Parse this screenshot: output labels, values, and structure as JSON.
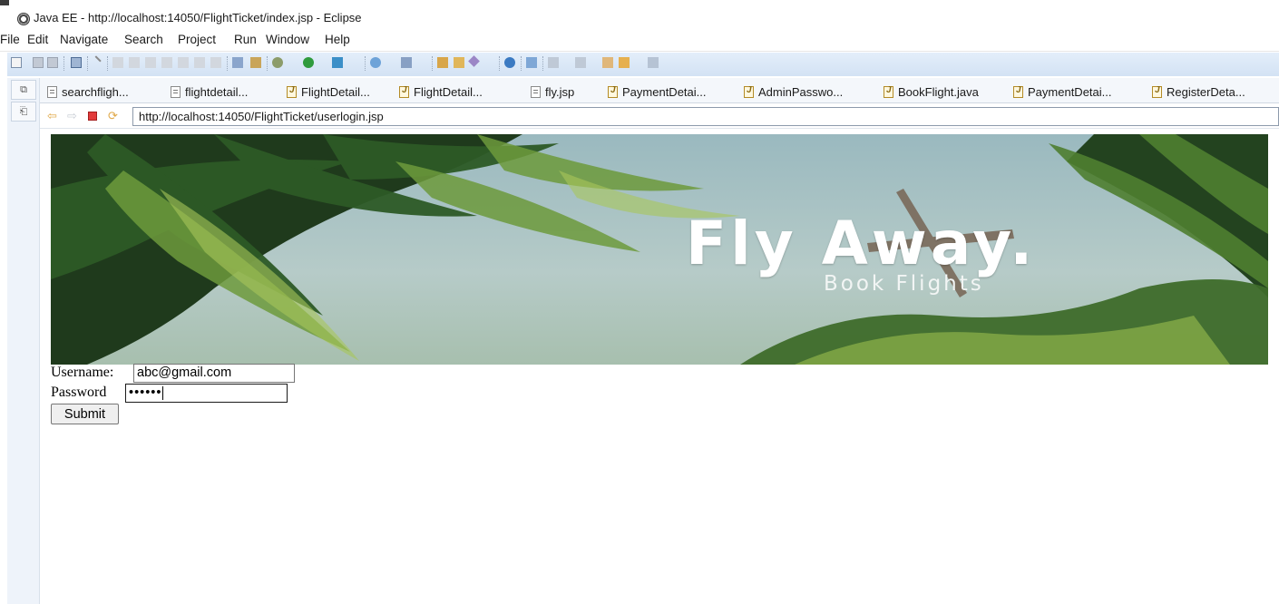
{
  "window": {
    "title": "Java EE - http://localhost:14050/FlightTicket/index.jsp - Eclipse"
  },
  "menu": [
    "File",
    "Edit",
    "Navigate",
    "Search",
    "Project",
    "Run",
    "Window",
    "Help"
  ],
  "tabs": [
    {
      "label": "searchfligh...",
      "icon": "jsp-file-icon"
    },
    {
      "label": "flightdetail...",
      "icon": "jsp-file-icon"
    },
    {
      "label": "FlightDetail...",
      "icon": "java-file-icon"
    },
    {
      "label": "FlightDetail...",
      "icon": "java-file-icon"
    },
    {
      "label": "fly.jsp",
      "icon": "jsp-file-icon"
    },
    {
      "label": "PaymentDetai...",
      "icon": "java-file-icon"
    },
    {
      "label": "AdminPasswo...",
      "icon": "java-file-icon"
    },
    {
      "label": "BookFlight.java",
      "icon": "java-file-icon"
    },
    {
      "label": "PaymentDetai...",
      "icon": "java-file-icon"
    },
    {
      "label": "RegisterDeta...",
      "icon": "java-file-icon"
    }
  ],
  "browser": {
    "url": "http://localhost:14050/FlightTicket/userlogin.jsp"
  },
  "banner": {
    "title": "Fly Away.",
    "subtitle": "Book Flights"
  },
  "form": {
    "username_label": "Username:",
    "username_value": "abc@gmail.com",
    "password_label": "Password",
    "password_value": "••••••",
    "submit_label": "Submit"
  },
  "colors": {
    "toolbar": "#d9e6f5",
    "url_border": "#8d9aab"
  }
}
